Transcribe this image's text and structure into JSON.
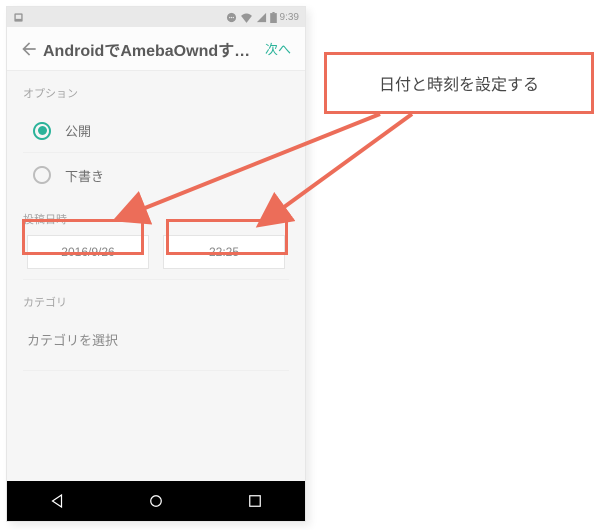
{
  "status_bar": {
    "time": "9:39"
  },
  "app_bar": {
    "title": "AndroidでAmebaOwndする…",
    "next_label": "次へ"
  },
  "options": {
    "section_label": "オプション",
    "public_label": "公開",
    "draft_label": "下書き"
  },
  "post_datetime": {
    "section_label": "投稿日時",
    "date_value": "2016/9/26",
    "time_value": "22:25"
  },
  "category": {
    "section_label": "カテゴリ",
    "select_placeholder": "カテゴリを選択"
  },
  "callout": {
    "text": "日付と時刻を設定する"
  }
}
